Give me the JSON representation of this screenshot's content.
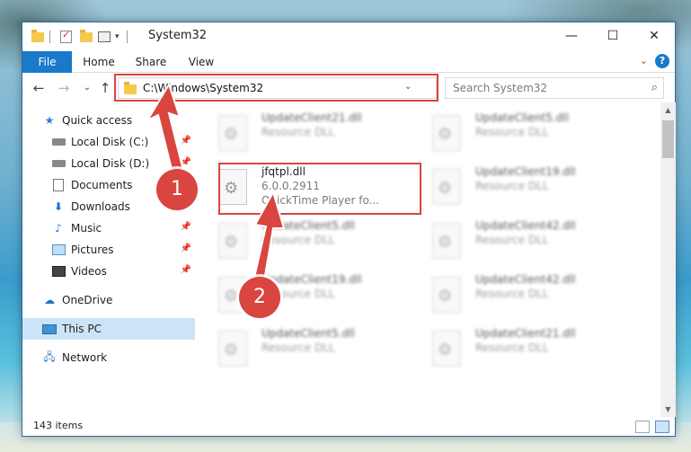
{
  "window": {
    "title": "System32",
    "minimize_glyph": "—",
    "maximize_glyph": "☐",
    "close_glyph": "✕"
  },
  "ribbon": {
    "tabs": [
      "File",
      "Home",
      "Share",
      "View"
    ],
    "expand_glyph": "⌄",
    "help_glyph": "?"
  },
  "nav": {
    "back_glyph": "←",
    "forward_glyph": "→",
    "recent_glyph": "⌄",
    "up_glyph": "↑",
    "address": "C:\\Windows\\System32",
    "address_dropdown_glyph": "⌄",
    "refresh_glyph": "↻",
    "search_placeholder": "Search System32",
    "search_glyph": "⌕"
  },
  "sidebar": {
    "items": [
      {
        "label": "Quick access",
        "icon": "star-icon"
      },
      {
        "label": "Local Disk (C:)",
        "icon": "drive-icon",
        "pinned": true
      },
      {
        "label": "Local Disk (D:)",
        "icon": "drive-icon",
        "pinned": true
      },
      {
        "label": "Documents",
        "icon": "documents-icon",
        "pinned": true
      },
      {
        "label": "Downloads",
        "icon": "downloads-icon",
        "pinned": true
      },
      {
        "label": "Music",
        "icon": "music-icon",
        "pinned": true
      },
      {
        "label": "Pictures",
        "icon": "pictures-icon",
        "pinned": true
      },
      {
        "label": "Videos",
        "icon": "videos-icon",
        "pinned": true
      },
      {
        "label": "OneDrive",
        "icon": "onedrive-icon"
      },
      {
        "label": "This PC",
        "icon": "this-pc-icon",
        "selected": true
      },
      {
        "label": "Network",
        "icon": "network-icon"
      }
    ],
    "pin_glyph": "📌"
  },
  "files": [
    {
      "name": "UpdateClient21.dll",
      "desc": "Resource DLL"
    },
    {
      "name": "UpdateClient5.dll",
      "desc": "Resource DLL"
    },
    {
      "name": "jfqtpl.dll",
      "desc": "6.0.0.2911",
      "desc2": "QuickTime Player fo..."
    },
    {
      "name": "UpdateClient19.dll",
      "desc": "Resource DLL"
    },
    {
      "name": "UpdateClient5.dll",
      "desc": "Resource DLL"
    },
    {
      "name": "UpdateClient42.dll",
      "desc": "Resource DLL"
    },
    {
      "name": "UpdateClient19.dll",
      "desc": "Resource DLL"
    },
    {
      "name": "UpdateClient42.dll",
      "desc": "Resource DLL"
    },
    {
      "name": "UpdateClient5.dll",
      "desc": "Resource DLL"
    },
    {
      "name": "UpdateClient21.dll",
      "desc": "Resource DLL"
    }
  ],
  "status": {
    "item_count": "143 items"
  },
  "callouts": [
    "1",
    "2"
  ],
  "colors": {
    "accent": "#1979ca",
    "highlight": "#d9453f",
    "selected": "#cce4f7"
  }
}
